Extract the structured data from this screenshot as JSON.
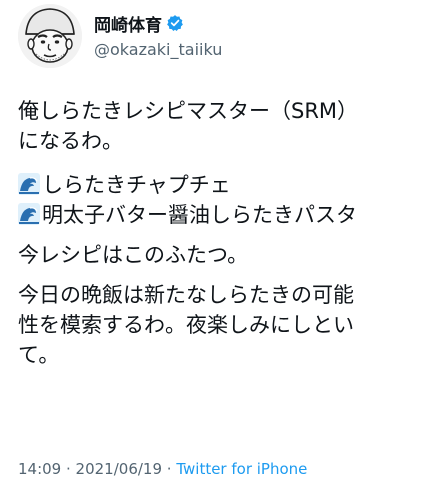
{
  "author": {
    "display_name": "岡崎体育",
    "handle": "@okazaki_taiiku",
    "verified": true,
    "avatar_icon": "caricature-avatar-icon"
  },
  "tweet": {
    "lines": {
      "intro": "俺しらたきレシピマスター（SRM）",
      "intro2": "になるわ。",
      "recipe1": "しらたきチャプチェ",
      "recipe2": "明太子バター醤油しらたきパスタ",
      "current": "今レシピはこのふたつ。",
      "closing1": "今日の晩飯は新たなしらたきの可能",
      "closing2": "性を模索するわ。夜楽しみにしとい",
      "closing3": "て。"
    },
    "recipe_icon": "wave-emoji-icon"
  },
  "footer": {
    "time": "14:09",
    "sep1": " · ",
    "date": "2021/06/19",
    "sep2": " · ",
    "source": "Twitter for iPhone"
  },
  "colors": {
    "text": "#0f1419",
    "secondary": "#536471",
    "link": "#1d9bf0",
    "verified": "#1d9bf0"
  }
}
